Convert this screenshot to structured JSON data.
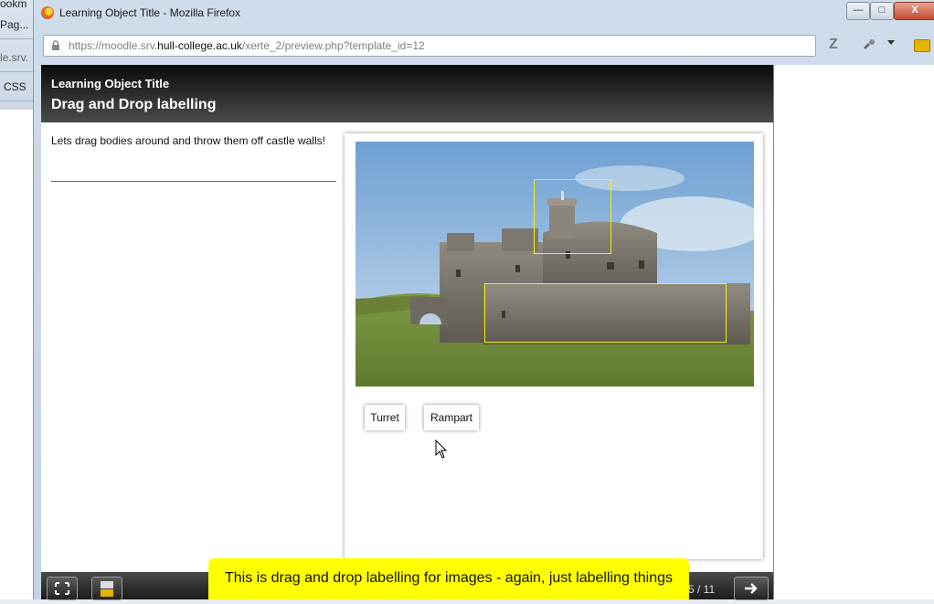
{
  "background_window": {
    "fragments": [
      "ookm",
      "Pag...",
      "le.srv.",
      "CSS"
    ]
  },
  "window": {
    "title": "Learning Object Title - Mozilla Firefox",
    "min_label": "—",
    "max_label": "□",
    "close_label": "X"
  },
  "urlbar": {
    "prefix": "https://moodle.srv.",
    "domain": "hull-college.ac.uk",
    "path": "/xerte_2/preview.php?template_id=12"
  },
  "toolbar": {
    "zotero_label": "Z"
  },
  "learning_object": {
    "header_title": "Learning Object Title",
    "page_title": "Drag and Drop labelling",
    "instructions": "Lets drag bodies around and throw them off castle walls!",
    "labels": [
      "Turret",
      "Rampart"
    ],
    "page_counter": "5 / 11"
  },
  "caption": {
    "text": "This is drag and drop labelling for images - again, just labelling things"
  },
  "colors": {
    "caption_bg": "#ffff00",
    "hotspot_border": "#f5f000",
    "header_bg": "#1a1a1a"
  }
}
